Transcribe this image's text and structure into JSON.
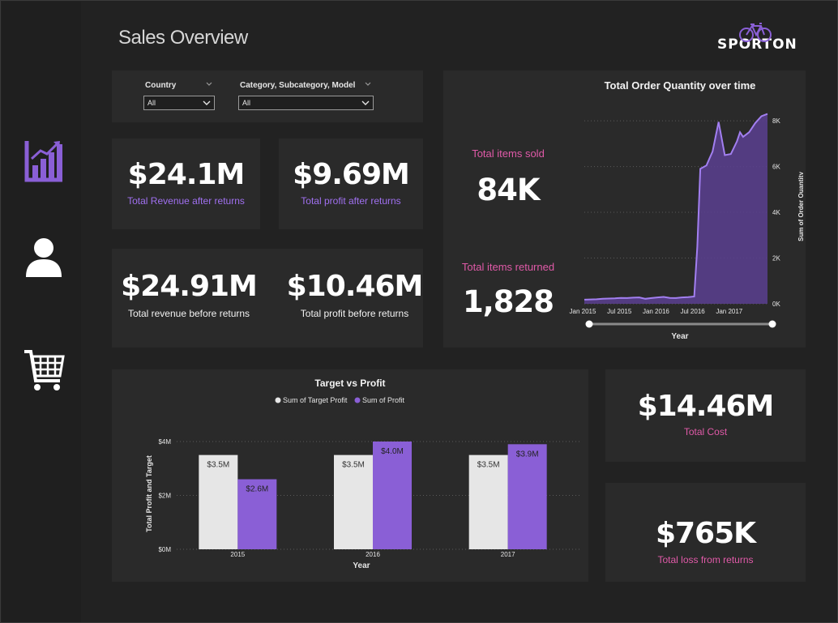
{
  "page": {
    "title": "Sales Overview"
  },
  "logo": {
    "text": "SPORTON"
  },
  "colors": {
    "accent": "#8a5fd6",
    "pink": "#e05aa8",
    "target_bar": "#e6e6e6",
    "card": "#2a2a2a",
    "background": "#222222"
  },
  "nav": [
    {
      "icon": "bar-chart-icon"
    },
    {
      "icon": "user-icon"
    },
    {
      "icon": "shopping-cart-icon"
    }
  ],
  "filters": {
    "country": {
      "label": "Country",
      "value": "All"
    },
    "category": {
      "label": "Category, Subcategory, Model",
      "value": "All"
    }
  },
  "kpis": {
    "revenue_after": {
      "value": "$24.1M",
      "label": "Total Revenue after returns"
    },
    "profit_after": {
      "value": "$9.69M",
      "label": "Total profit after returns"
    },
    "revenue_before": {
      "value": "$24.91M",
      "label": "Total revenue before returns"
    },
    "profit_before": {
      "value": "$10.46M",
      "label": "Total profit before returns"
    },
    "items_sold": {
      "value": "84K",
      "label": "Total items sold"
    },
    "items_returned": {
      "value": "1,828",
      "label": "Total items returned"
    },
    "total_cost": {
      "value": "$14.46M",
      "label": "Total Cost"
    },
    "loss_returns": {
      "value": "$765K",
      "label": "Total loss from returns"
    }
  },
  "chart_data": [
    {
      "type": "area",
      "title": "Total Order Quantity over time",
      "xlabel": "Year",
      "ylabel": "Sum of Order Quantity",
      "ylim": [
        0,
        8500
      ],
      "y_ticks": [
        0,
        2000,
        4000,
        6000,
        8000
      ],
      "y_tick_labels": [
        "0K",
        "2K",
        "4K",
        "6K",
        "8K"
      ],
      "x_tick_labels": [
        "Jan 2015",
        "Jul 2015",
        "Jan 2016",
        "Jul 2016",
        "Jan 2017"
      ],
      "x_tick_months": [
        0,
        6,
        12,
        18,
        24
      ],
      "grid": true,
      "x": [
        0,
        1,
        2,
        3,
        4,
        5,
        6,
        7,
        8,
        9,
        10,
        11,
        12,
        13,
        14,
        15,
        16,
        17,
        18,
        18.5,
        19,
        20,
        20.5,
        21,
        22,
        23,
        24,
        25,
        25.5,
        26,
        27,
        28,
        29,
        30
      ],
      "values": [
        180,
        190,
        200,
        220,
        230,
        240,
        260,
        250,
        270,
        280,
        220,
        250,
        280,
        300,
        260,
        250,
        280,
        290,
        320,
        2500,
        5900,
        6050,
        6350,
        6650,
        7950,
        6500,
        6550,
        7100,
        7500,
        7300,
        7500,
        7900,
        8200,
        8300
      ]
    },
    {
      "type": "bar",
      "title": "Target vs Profit",
      "xlabel": "Year",
      "ylabel": "Total Profit and Target",
      "categories": [
        "2015",
        "2016",
        "2017"
      ],
      "ylim": [
        0,
        4000000
      ],
      "y_ticks": [
        0,
        2000000,
        4000000
      ],
      "y_tick_labels": [
        "$0M",
        "$2M",
        "$4M"
      ],
      "legend_position": "top",
      "series": [
        {
          "name": "Sum of Target Profit",
          "values": [
            3500000,
            3500000,
            3500000
          ],
          "labels": [
            "$3.5M",
            "$3.5M",
            "$3.5M"
          ],
          "color": "#e6e6e6"
        },
        {
          "name": "Sum of Profit",
          "values": [
            2600000,
            4000000,
            3900000
          ],
          "labels": [
            "$2.6M",
            "$4.0M",
            "$3.9M"
          ],
          "color": "#8a5fd6"
        }
      ]
    }
  ]
}
